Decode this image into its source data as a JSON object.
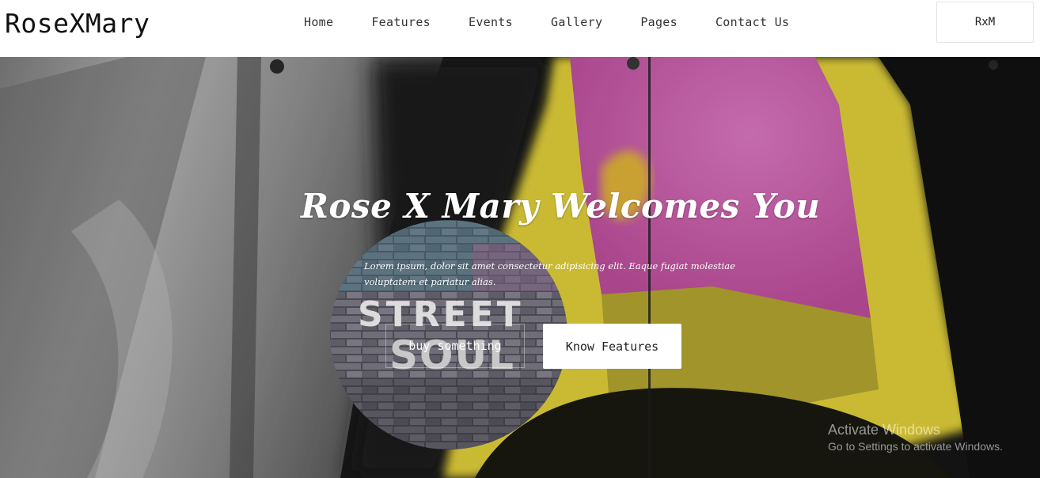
{
  "brand": "RoseXMary",
  "nav": {
    "items": [
      "Home",
      "Features",
      "Events",
      "Gallery",
      "Pages",
      "Contact Us"
    ]
  },
  "header_button": "RxM",
  "hero": {
    "title": "Rose X Mary Welcomes You",
    "lead": "Lorem ipsum, dolor sit amet consectetur adipisicing elit. Eaque fugiat molestiae voluptatem et pariatur alias.",
    "badge_text_top": "STREET",
    "badge_text_bottom": "SOUL",
    "button_primary": "buy something",
    "button_secondary": "Know Features"
  },
  "watermark": {
    "line1": "Activate Windows",
    "line2": "Go to Settings to activate Windows."
  },
  "colors": {
    "graffiti_pink": "#d75fb4",
    "graffiti_yellow": "#e8d63a",
    "wall_black": "#141414",
    "wall_silver": "#a8a8a8"
  }
}
